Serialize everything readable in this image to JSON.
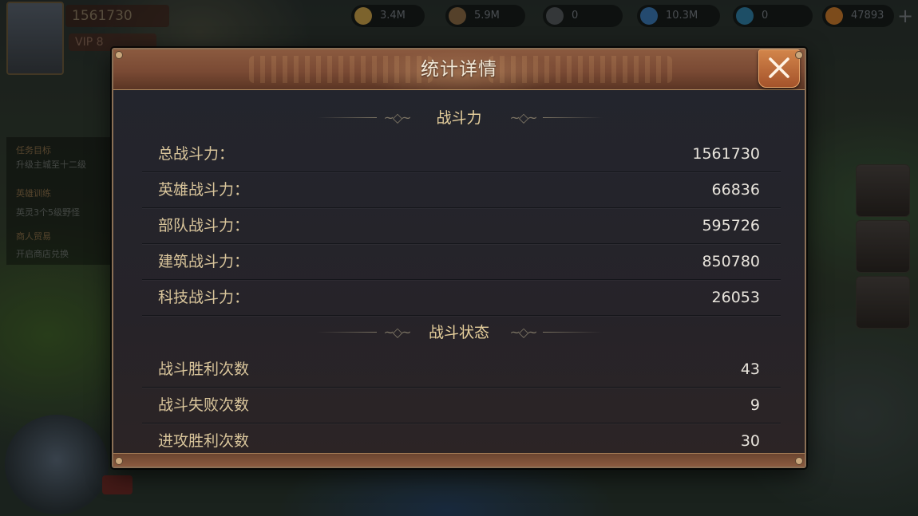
{
  "hud": {
    "power": "1561730",
    "vip": "VIP 8",
    "resources": [
      {
        "icon": "food-icon",
        "value": "3.4M",
        "color": "#c9a14a"
      },
      {
        "icon": "wood-icon",
        "value": "5.9M",
        "color": "#8a6a44"
      },
      {
        "icon": "stone-icon",
        "value": "0",
        "color": "#55595d"
      },
      {
        "icon": "crystal-icon",
        "value": "10.3M",
        "color": "#3b78b4"
      },
      {
        "icon": "gem-icon",
        "value": "0",
        "color": "#2f7fa5"
      },
      {
        "icon": "gold-icon",
        "value": "47893",
        "color": "#c97a2c"
      }
    ]
  },
  "quests": [
    "任务目标",
    "升级主城至十二级",
    "英雄训练",
    "英灵3个5级野怪",
    "商人贸易",
    "开启商店兑换"
  ],
  "dialog": {
    "title": "统计详情",
    "sections": [
      {
        "title": "战斗力",
        "rows": [
          {
            "label": "总战斗力：",
            "value": "1561730"
          },
          {
            "label": "英雄战斗力：",
            "value": "66836"
          },
          {
            "label": "部队战斗力：",
            "value": "595726"
          },
          {
            "label": "建筑战斗力：",
            "value": "850780"
          },
          {
            "label": "科技战斗力：",
            "value": "26053"
          }
        ]
      },
      {
        "title": "战斗状态",
        "rows": [
          {
            "label": "战斗胜利次数",
            "value": "43"
          },
          {
            "label": "战斗失败次数",
            "value": "9"
          },
          {
            "label": "进攻胜利次数",
            "value": "30"
          }
        ]
      }
    ]
  }
}
